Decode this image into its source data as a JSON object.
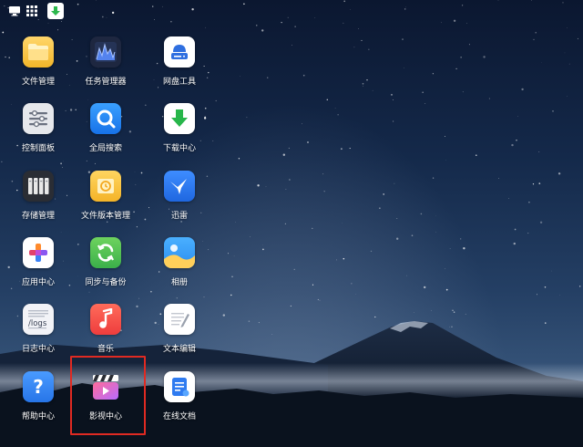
{
  "taskbar": {
    "buttons": [
      {
        "name": "show-desktop",
        "icon": "monitor-icon"
      },
      {
        "name": "app-menu",
        "icon": "grid-icon"
      },
      {
        "name": "download-manager",
        "icon": "download-arrow-icon",
        "accent": "#2db84d"
      }
    ]
  },
  "apps": [
    {
      "label": "文件管理",
      "icon": "folder-icon"
    },
    {
      "label": "任务管理器",
      "icon": "activity-monitor-icon"
    },
    {
      "label": "网盘工具",
      "icon": "cloud-drive-icon"
    },
    {
      "label": "控制面板",
      "icon": "sliders-icon"
    },
    {
      "label": "全局搜索",
      "icon": "search-icon"
    },
    {
      "label": "下载中心",
      "icon": "download-icon"
    },
    {
      "label": "存储管理",
      "icon": "storage-bays-icon"
    },
    {
      "label": "文件版本管理",
      "icon": "version-history-icon"
    },
    {
      "label": "迅雷",
      "icon": "thunder-bird-icon"
    },
    {
      "label": "应用中心",
      "icon": "app-center-icon"
    },
    {
      "label": "同步与备份",
      "icon": "sync-icon"
    },
    {
      "label": "相册",
      "icon": "photo-album-icon"
    },
    {
      "label": "日志中心",
      "icon": "logs-icon",
      "icon_text": "/logs"
    },
    {
      "label": "音乐",
      "icon": "music-note-icon"
    },
    {
      "label": "文本编辑",
      "icon": "text-editor-icon"
    },
    {
      "label": "帮助中心",
      "icon": "help-icon",
      "icon_text": "?"
    },
    {
      "label": "影视中心",
      "icon": "clapperboard-icon",
      "highlighted": true
    },
    {
      "label": "在线文档",
      "icon": "online-doc-icon"
    }
  ],
  "colors": {
    "highlight": "#e02a22",
    "label_text": "#ffffff"
  }
}
